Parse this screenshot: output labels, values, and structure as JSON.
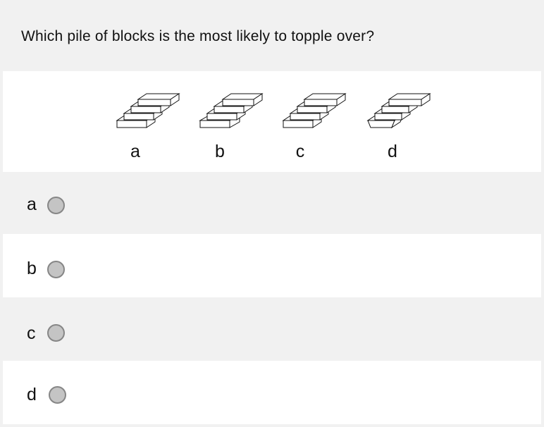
{
  "question": {
    "text": "Which pile of blocks is the most likely to topple over?"
  },
  "figure": {
    "labels": [
      "a",
      "b",
      "c",
      "d"
    ]
  },
  "options": [
    {
      "label": "a",
      "selected": false
    },
    {
      "label": "b",
      "selected": false
    },
    {
      "label": "c",
      "selected": false
    },
    {
      "label": "d",
      "selected": false
    }
  ]
}
